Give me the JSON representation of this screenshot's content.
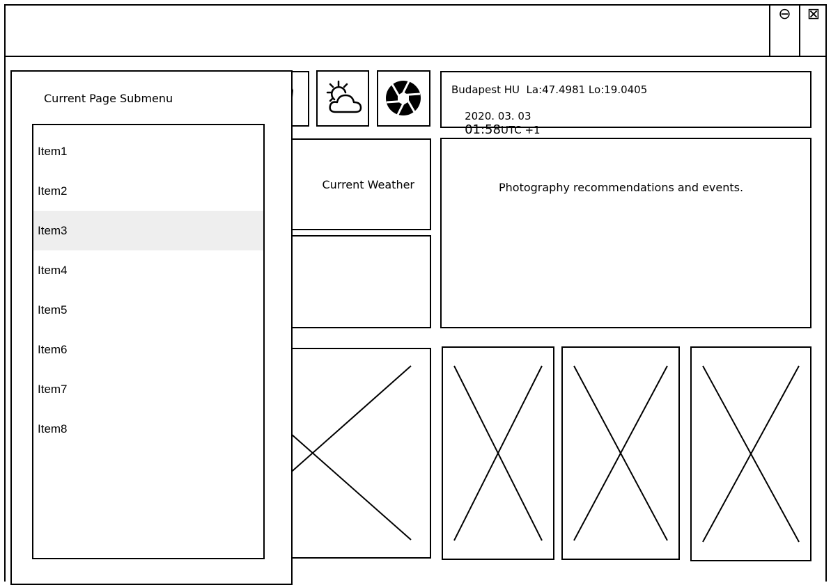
{
  "window": {
    "minimize_label": "⊖",
    "close_label": "⊠"
  },
  "toolbar": {
    "icons": [
      "map-icon",
      "partly-cloudy-icon",
      "camera-aperture-icon"
    ]
  },
  "location": {
    "line1": "Budapest HU  La:47.4981 Lo:19.0405",
    "date": "2020. 03. 03",
    "time": "01:58",
    "tz": "UTC +1"
  },
  "weather": {
    "label": "Current Weather"
  },
  "recommendations": {
    "text": "Photography recommendations and events."
  },
  "submenu": {
    "title": "Current Page Submenu",
    "selected_index": 2,
    "items": [
      "Item1",
      "Item2",
      "Item3",
      "Item4",
      "Item5",
      "Item6",
      "Item7",
      "Item8"
    ]
  }
}
